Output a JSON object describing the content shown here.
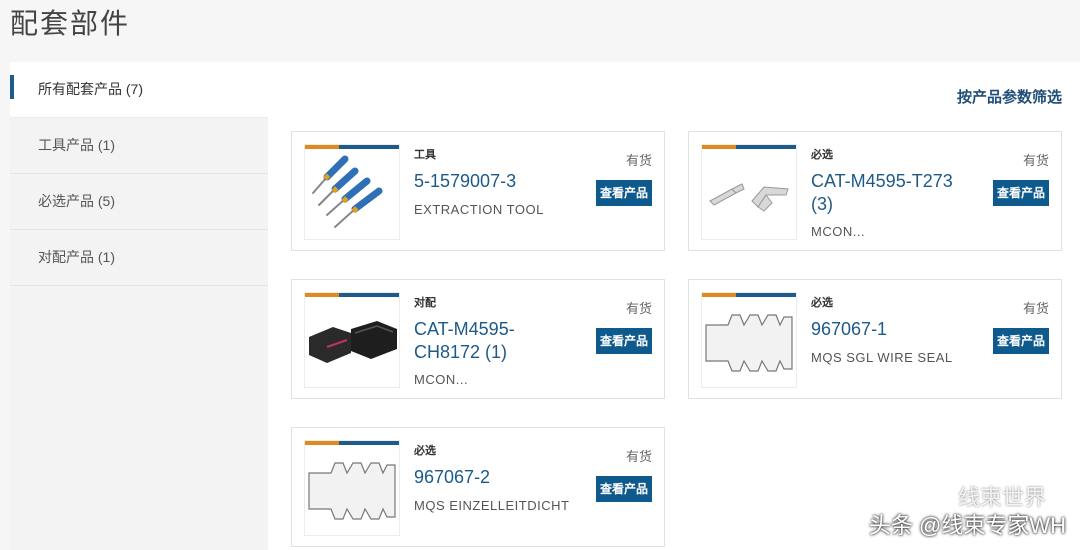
{
  "page": {
    "title": "配套部件"
  },
  "sidebar": {
    "items": [
      {
        "label": "所有配套产品 (7)"
      },
      {
        "label": "工具产品 (1)"
      },
      {
        "label": "必选产品 (5)"
      },
      {
        "label": "对配产品 (1)"
      }
    ]
  },
  "filter": {
    "label": "按产品参数筛选"
  },
  "products": [
    {
      "category": "工具",
      "part_number": "5-1579007-3",
      "description": "EXTRACTION TOOL",
      "stock": "有货",
      "button": "查看产品",
      "thumb_icon": "extraction-tool-image"
    },
    {
      "category": "必选",
      "part_number": "CAT-M4595-T273 (3)",
      "description": "MCON...",
      "stock": "有货",
      "button": "查看产品",
      "thumb_icon": "terminal-contacts-image"
    },
    {
      "category": "对配",
      "part_number": "CAT-M4595-CH8172 (1)",
      "description": "MCON...",
      "stock": "有货",
      "button": "查看产品",
      "thumb_icon": "connector-housings-image"
    },
    {
      "category": "必选",
      "part_number": "967067-1",
      "description": "MQS SGL WIRE SEAL",
      "stock": "有货",
      "button": "查看产品",
      "thumb_icon": "wire-seal-image"
    },
    {
      "category": "必选",
      "part_number": "967067-2",
      "description": "MQS EINZELLEITDICHT",
      "stock": "有货",
      "button": "查看产品",
      "thumb_icon": "wire-seal-image"
    }
  ],
  "watermark": {
    "text": "头条 @线束专家WH",
    "logo_text": "线束世界"
  },
  "colors": {
    "accent_blue": "#0f5a8c",
    "accent_orange": "#e0891c",
    "link_blue": "#1d5a8a"
  }
}
